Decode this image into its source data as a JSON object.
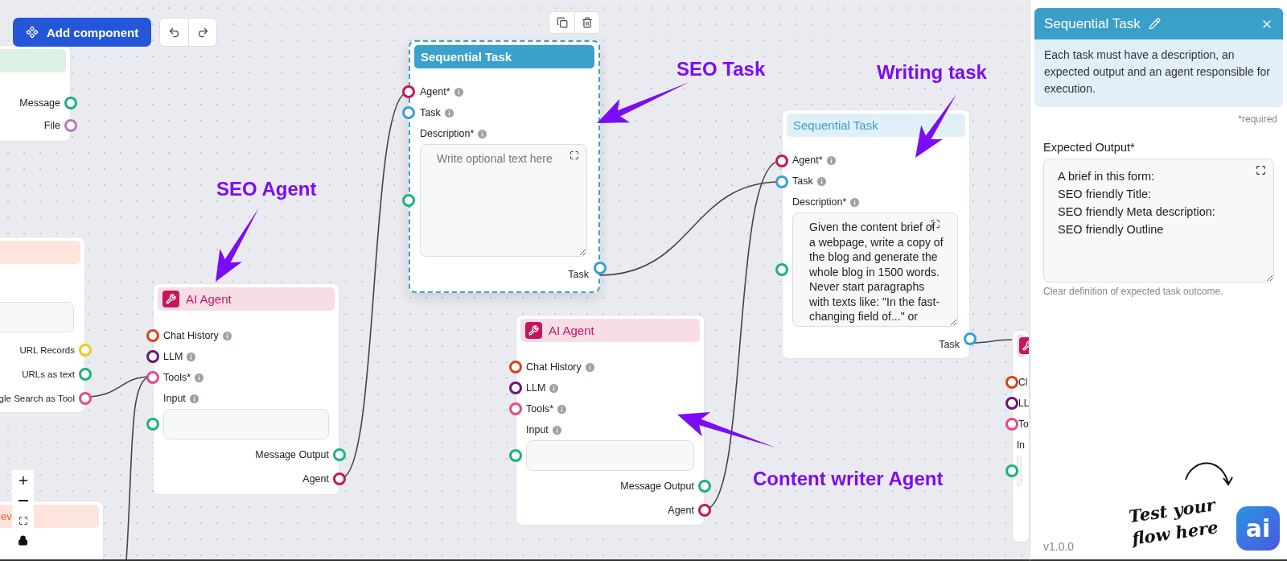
{
  "toolbar": {
    "add_label": "Add component"
  },
  "stubs": [
    {
      "color": "#dcf0e4",
      "outputs": [
        {
          "label": "Message",
          "color": "#19b37c"
        },
        {
          "label": "File",
          "color": "#b47ac0"
        }
      ]
    },
    {
      "color": "#fde4dc",
      "field": true,
      "outputs": [
        {
          "label": "URL Records",
          "color": "#f5c518"
        },
        {
          "label": "URLs as text",
          "color": "#19b37c"
        },
        {
          "label": "gle Search as Tool",
          "color": "#e5498e"
        }
      ]
    },
    {
      "color": "#fde4dc",
      "title": "ev"
    }
  ],
  "agents": [
    {
      "title": "AI Agent",
      "inputs": [
        {
          "label": "Chat History",
          "color": "#d64516",
          "info": true
        },
        {
          "label": "LLM",
          "color": "#65177a",
          "info": true
        },
        {
          "label": "Tools*",
          "color": "#e5498e",
          "info": true
        }
      ],
      "input": {
        "label": "Input",
        "color": "#19b37c",
        "info": true
      },
      "outputs": [
        {
          "label": "Message Output",
          "color": "#19b37c"
        },
        {
          "label": "Agent",
          "color": "#c2185b"
        }
      ]
    },
    {
      "title": "AI Agent",
      "inputs": [
        {
          "label": "Chat History",
          "color": "#d64516",
          "info": true
        },
        {
          "label": "LLM",
          "color": "#65177a",
          "info": true
        },
        {
          "label": "Tools*",
          "color": "#e5498e",
          "info": true
        }
      ],
      "input": {
        "label": "Input",
        "color": "#19b37c",
        "info": true
      },
      "outputs": [
        {
          "label": "Message Output",
          "color": "#19b37c"
        },
        {
          "label": "Agent",
          "color": "#c2185b"
        }
      ]
    },
    {
      "inputs": [
        {
          "label": "Cl",
          "color": "#d64516"
        },
        {
          "label": "LL",
          "color": "#65177a"
        },
        {
          "label": "To",
          "color": "#e5498e"
        }
      ],
      "input": {
        "label": "In",
        "color": "#19b37c"
      }
    }
  ],
  "tasks": [
    {
      "selected": true,
      "title": "Sequential Task",
      "inputs": [
        {
          "label": "Agent*",
          "color": "#c2185b",
          "info": true
        },
        {
          "label": "Task",
          "color": "#3aa0cf",
          "info": true
        }
      ],
      "description": {
        "label": "Description*",
        "placeholder": "Write optional text here",
        "color": "#19b37c"
      },
      "output": {
        "label": "Task",
        "color": "#3aa0cf"
      }
    },
    {
      "selected": false,
      "title": "Sequential Task",
      "inputs": [
        {
          "label": "Agent*",
          "color": "#c2185b",
          "info": true
        },
        {
          "label": "Task",
          "color": "#3aa0cf",
          "info": true
        }
      ],
      "description": {
        "label": "Description*",
        "value": "Given the content brief of a webpage, write a copy of the blog and generate the whole blog in 1500 words. Never start paragraphs with texts like: \"In the fast-changing field of...\" or",
        "color": "#19b37c"
      },
      "output": {
        "label": "Task",
        "color": "#3aa0cf"
      }
    }
  ],
  "annotations": [
    {
      "text": "SEO Agent"
    },
    {
      "text": "SEO Task"
    },
    {
      "text": "Writing task"
    },
    {
      "text": "Content writer Agent"
    }
  ],
  "panel": {
    "title": "Sequential Task",
    "info": "Each task must have a description, an expected output and an agent responsible for execution.",
    "required_note": "*required",
    "field_label": "Expected Output*",
    "field_value": "A brief in this form:\nSEO friendly Title:\nSEO friendly Meta description:\nSEO friendly Outline",
    "field_help": "Clear definition of expected task outcome.",
    "version": "v1.0.0"
  },
  "hint": "Test your flow here",
  "chat_button": "ai"
}
